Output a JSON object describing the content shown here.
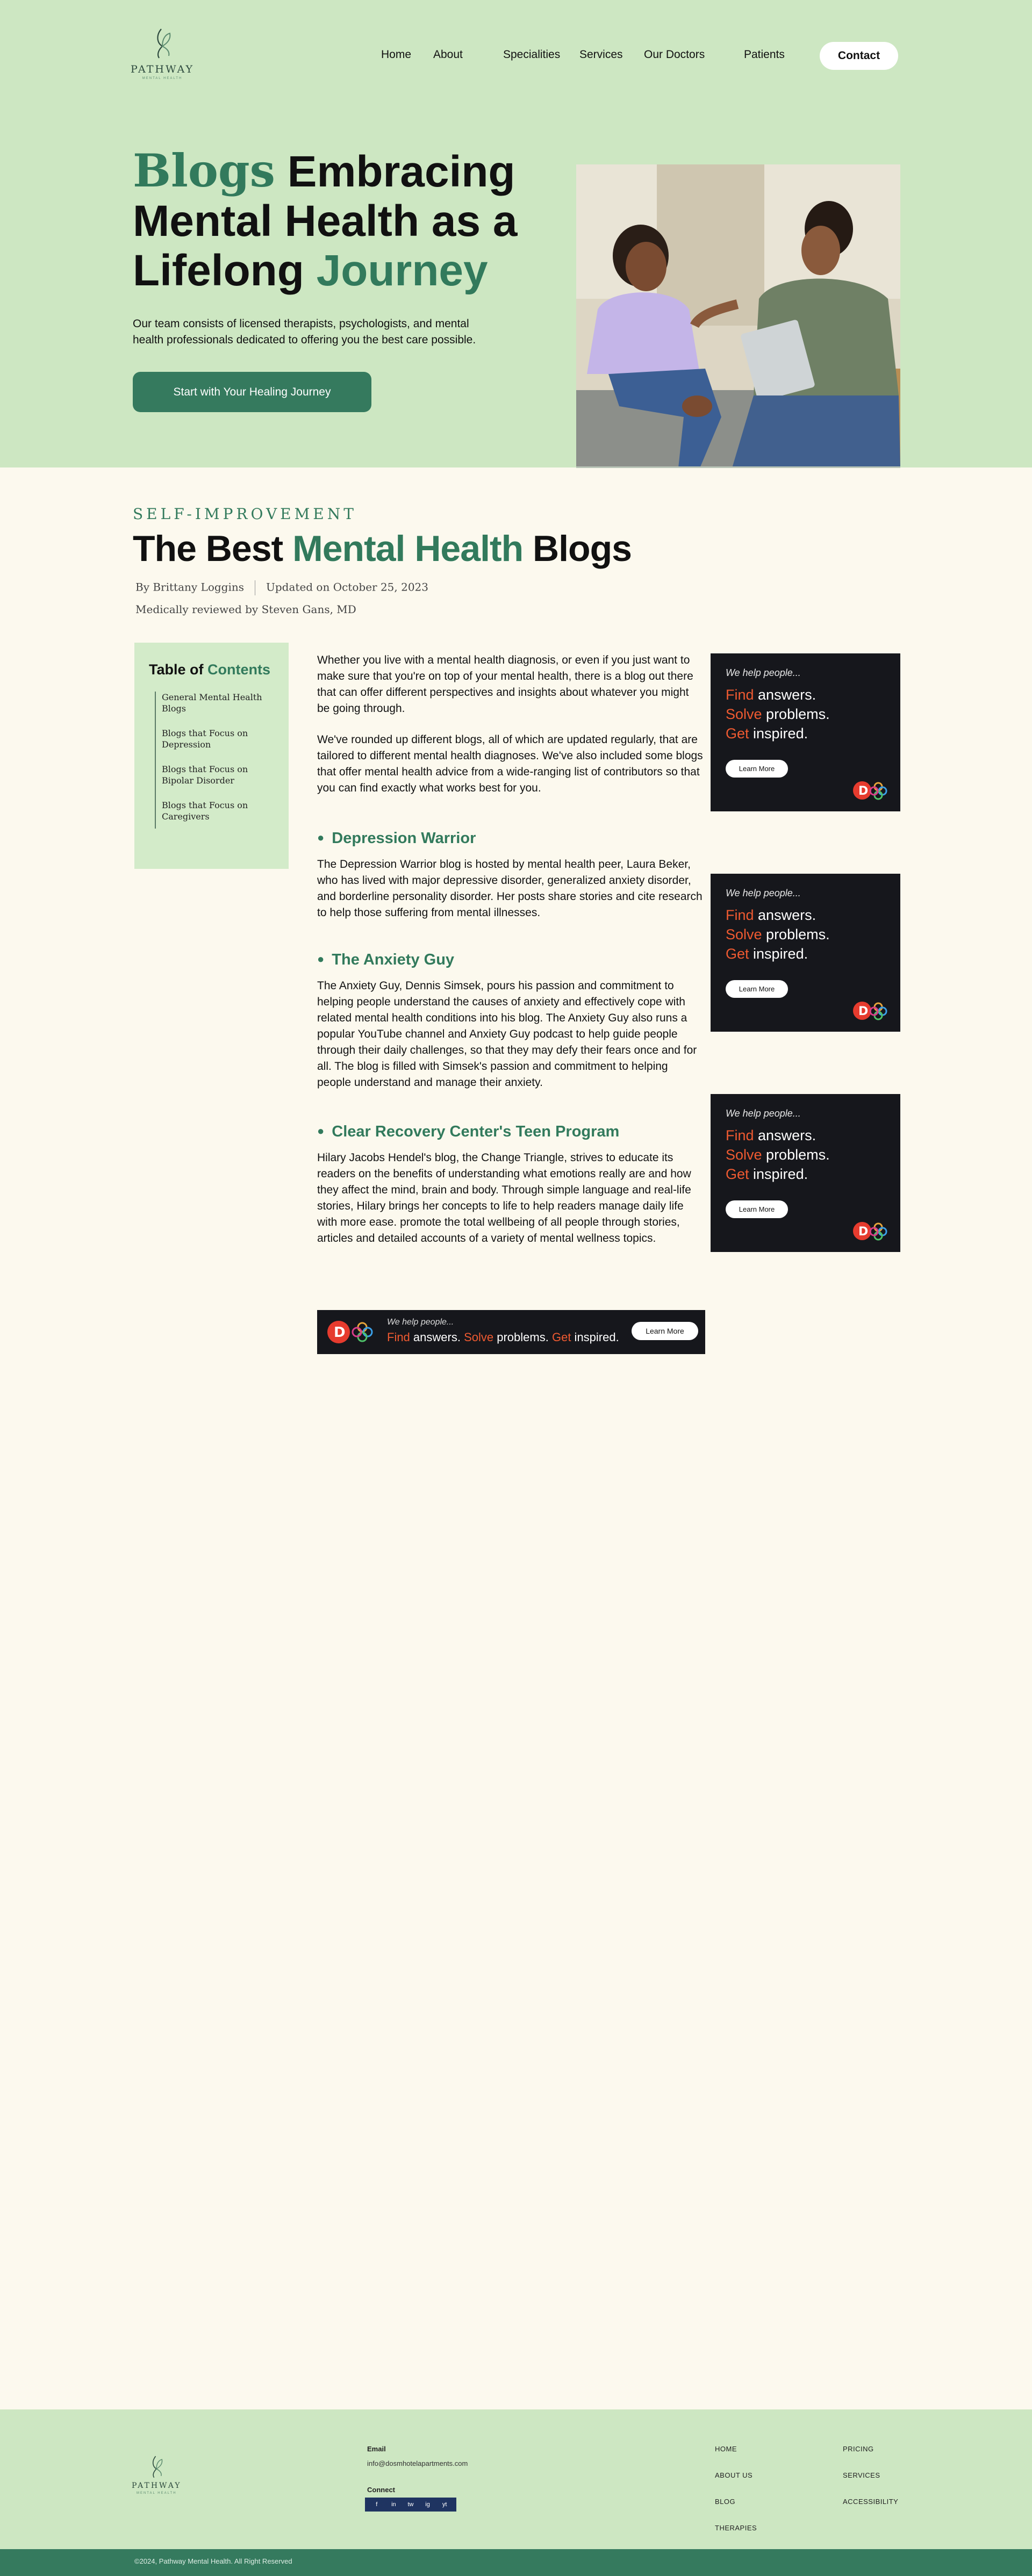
{
  "brand": {
    "name": "PATHWAY",
    "tagline": "MENTAL HEALTH"
  },
  "nav": {
    "items": [
      "Home",
      "About",
      "Specialities",
      "Services",
      "Our Doctors",
      "Patients"
    ],
    "contact_label": "Contact"
  },
  "hero": {
    "title_word1": "Blogs",
    "title_rest1": " Embracing",
    "title_line2": "Mental Health as a",
    "title_line3a": "Lifelong ",
    "title_line3b": "Journey",
    "description": "Our team consists of licensed therapists, psychologists, and mental health professionals dedicated to offering you the best care possible.",
    "cta_label": "Start with Your Healing Journey"
  },
  "article": {
    "kicker": "SELF-IMPROVEMENT",
    "title_part1": "The Best ",
    "title_part2": "Mental Health",
    "title_part3": " Blogs",
    "author": "By Brittany Loggins",
    "updated": "Updated on October 25, 2023",
    "reviewed": "Medically reviewed by Steven Gans, MD",
    "intro1": "Whether you live with a mental health diagnosis, or even if you just want to make sure that you're on top of your mental health, there is a blog out there that can offer different perspectives and insights about whatever you might be going through.",
    "intro2": "We've rounded up different blogs, all of which are updated regularly, that are tailored to different mental health diagnoses. We've also included some blogs that offer mental health advice from a wide-ranging list of contributors so that you can find exactly what works best for you.",
    "sections": [
      {
        "heading": "Depression Warrior",
        "body": "The Depression Warrior blog is hosted by mental health peer, Laura Beker, who has lived with major depressive disorder, generalized anxiety disorder, and borderline personality disorder. Her posts share stories and cite research to help those suffering from mental illnesses."
      },
      {
        "heading": "The Anxiety Guy",
        "body": "The Anxiety Guy, Dennis Simsek, pours his passion and commitment to helping people understand the causes of anxiety and effectively cope with related mental health conditions into his blog. The Anxiety Guy also runs a popular YouTube channel and Anxiety Guy podcast to help guide people through their daily challenges, so that they may defy their fears once and for all. The blog is filled with Simsek's passion and commitment to helping people understand and manage their anxiety."
      },
      {
        "heading": "Clear Recovery Center's Teen Program",
        "body": "Hilary Jacobs Hendel's blog, the Change Triangle, strives to educate its readers on the benefits of understanding what emotions really are and how they affect the mind, brain and body. Through simple language and real-life stories, Hilary brings her concepts to life to help readers manage daily life with more ease. promote the total wellbeing of all people through stories, articles and detailed accounts of a variety of mental wellness topics."
      }
    ]
  },
  "toc": {
    "title_part1": "Table of ",
    "title_part2": "Contents",
    "items": [
      "General Mental Health Blogs",
      "Blogs that Focus on Depression",
      "Blogs that Focus on Bipolar Disorder",
      "Blogs that Focus on Caregivers"
    ]
  },
  "ad": {
    "tagline": "We help people...",
    "find": "Find",
    "answers": " answers.",
    "solve": "Solve",
    "problems": " problems.",
    "get": "Get",
    "inspired": " inspired.",
    "learn_more": "Learn More",
    "colors": {
      "background": "#16171c",
      "accent": "#ef5a31"
    }
  },
  "footer": {
    "email_label": "Email",
    "email": "info@dosmhotelapartments.com",
    "connect_label": "Connect",
    "socials": [
      "f",
      "in",
      "tw",
      "ig",
      "yt"
    ],
    "links_col1": [
      "HOME",
      "ABOUT US",
      "BLOG",
      "THERAPIES"
    ],
    "links_col2": [
      "PRICING",
      "SERVICES",
      "ACCESSIBILITY"
    ],
    "copyright": "©2024, Pathway Mental Health. All Right Reserved"
  },
  "theme": {
    "hero_bg": "#cde7c2",
    "page_bg": "#fcf9ee",
    "accent_green": "#327a5c",
    "button_green": "#357a5e"
  }
}
